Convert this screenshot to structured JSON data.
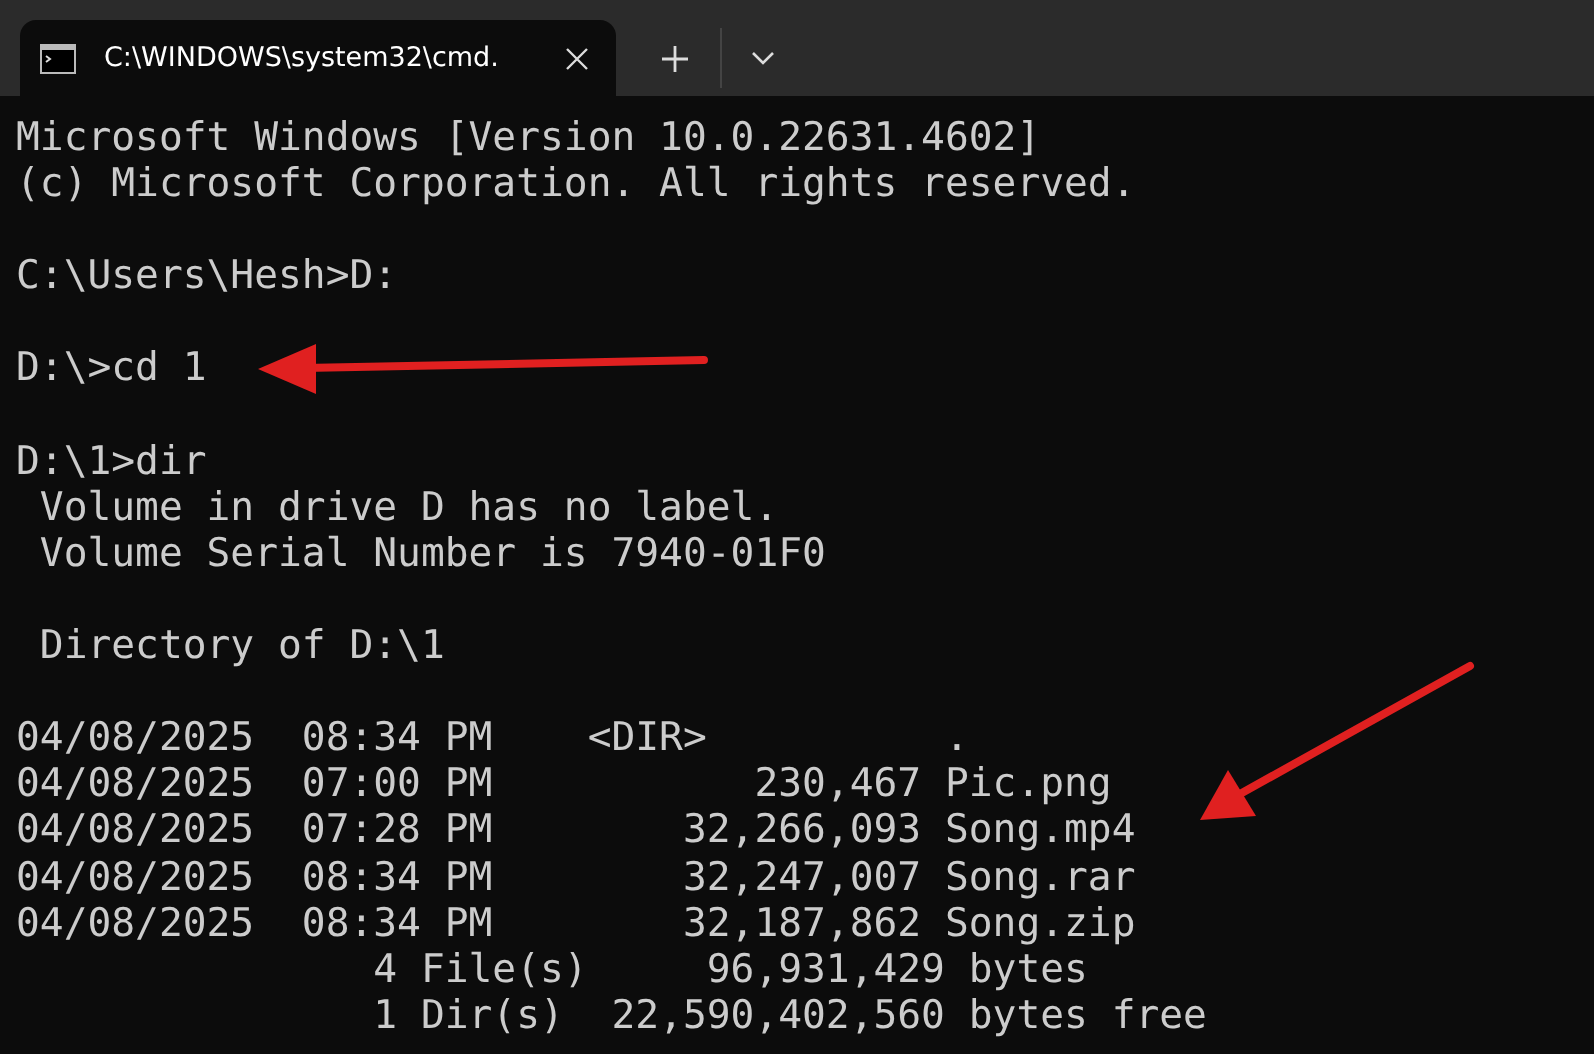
{
  "tab": {
    "title": "C:\\WINDOWS\\system32\\cmd."
  },
  "terminal": {
    "blocks": [
      [
        "Microsoft Windows [Version 10.0.22631.4602]",
        "(c) Microsoft Corporation. All rights reserved."
      ],
      [
        "C:\\Users\\Hesh>D:"
      ],
      [
        "D:\\>cd 1"
      ],
      [
        "D:\\1>dir",
        " Volume in drive D has no label.",
        " Volume Serial Number is 7940-01F0"
      ],
      [
        " Directory of D:\\1"
      ],
      [
        "04/08/2025  08:34 PM    <DIR>          .",
        "04/08/2025  07:00 PM           230,467 Pic.png",
        "04/08/2025  07:28 PM        32,266,093 Song.mp4",
        "04/08/2025  08:34 PM        32,247,007 Song.rar",
        "04/08/2025  08:34 PM        32,187,862 Song.zip",
        "               4 File(s)     96,931,429 bytes",
        "               1 Dir(s)  22,590,402,560 bytes free"
      ]
    ]
  }
}
